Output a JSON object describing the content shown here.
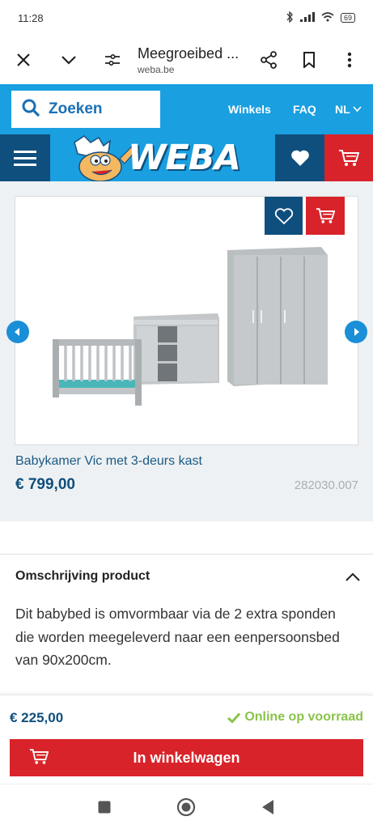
{
  "status": {
    "time": "11:28",
    "battery": "69"
  },
  "browser": {
    "title": "Meegroeibed ...",
    "host": "weba.be"
  },
  "header": {
    "search_label": "Zoeken",
    "links": [
      "Winkels",
      "FAQ",
      "NL"
    ],
    "logo_text": "WEBA"
  },
  "product": {
    "name": "Babykamer Vic met 3-deurs kast",
    "price": "€ 799,00",
    "sku": "282030.007"
  },
  "description": {
    "title": "Omschrijving product",
    "text": "Dit babybed is omvormbaar via de 2 extra sponden die worden meegeleverd naar een eenpersoonsbed van 90x200cm."
  },
  "buy": {
    "price": "€ 225,00",
    "stock": "Online op voorraad",
    "button": "In winkelwagen"
  },
  "colors": {
    "accent": "#1a9fe0",
    "navy": "#0f4f7d",
    "red": "#d8232a",
    "stock_green": "#8bc34a"
  }
}
